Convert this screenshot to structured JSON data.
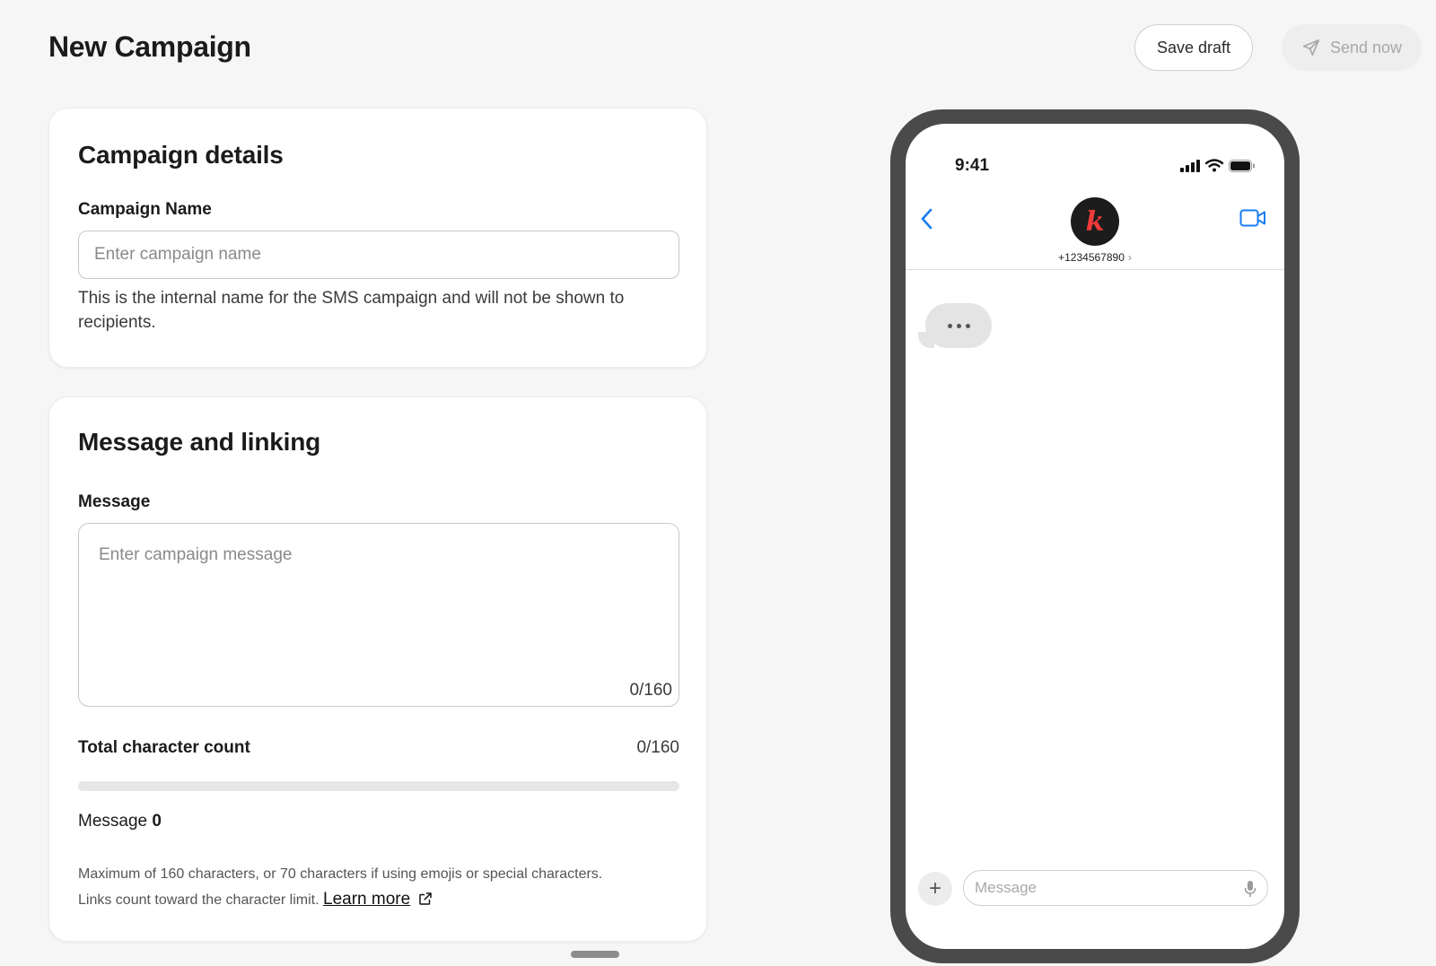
{
  "header": {
    "title": "New Campaign",
    "save_label": "Save draft",
    "send_label": "Send now"
  },
  "details": {
    "heading": "Campaign details",
    "name_label": "Campaign Name",
    "name_placeholder": "Enter campaign name",
    "name_value": "",
    "helper": "This is the internal name for the SMS campaign and will not be shown to recipients."
  },
  "message": {
    "heading": "Message and linking",
    "label": "Message",
    "placeholder": "Enter campaign message",
    "value": "",
    "counter": "0/160",
    "total_label": "Total character count",
    "total_count": "0/160",
    "progress": 0,
    "msg_label": "Message",
    "msg_count": "0",
    "fineprint_line1": "Maximum of 160 characters, or 70 characters if using emojis or special characters.",
    "fineprint_line2": "Links count toward the character limit.",
    "learn_more": "Learn more"
  },
  "phone": {
    "time": "9:41",
    "contact_number": "+1234567890",
    "number_chevron": "›",
    "avatar_letter": "k",
    "input_placeholder": "Message",
    "plus_glyph": "+"
  },
  "colors": {
    "accent_blue": "#1a7cf0",
    "phone_frame": "#4a4a4a",
    "avatar_letter": "#ef3b3b"
  }
}
